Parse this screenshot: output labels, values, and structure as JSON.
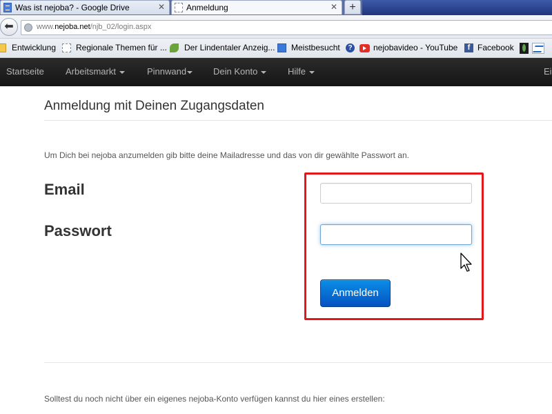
{
  "browser": {
    "tabs": [
      {
        "label": "Was ist nejoba? - Google Drive",
        "icon": "google-docs-icon",
        "close": "✕"
      },
      {
        "label": "Anmeldung",
        "icon": "blank-page-icon",
        "close": "✕"
      }
    ],
    "new_tab": "+",
    "url": {
      "prefix": "www.",
      "domain": "nejoba.net",
      "path": "/njb_02/login.aspx"
    },
    "bookmarks": [
      {
        "label": "Entwicklung",
        "icon": "folder-icon"
      },
      {
        "label": "Regionale Themen für ...",
        "icon": "blank-page-icon"
      },
      {
        "label": "Der Lindentaler Anzeig...",
        "icon": "leaf-icon"
      },
      {
        "label": "Meistbesucht",
        "icon": "star-icon"
      },
      {
        "label": "?",
        "icon": "help-icon"
      },
      {
        "label": "nejobavideo - YouTube",
        "icon": "youtube-icon"
      },
      {
        "label": "Facebook",
        "icon": "facebook-icon"
      }
    ],
    "facebook_glyph": "f"
  },
  "sitenav": {
    "items": [
      {
        "label": "Startseite",
        "dropdown": false
      },
      {
        "label": "Arbeitsmarkt",
        "dropdown": true
      },
      {
        "label": "Pinnwand",
        "dropdown": true
      },
      {
        "label": "Dein Konto",
        "dropdown": true
      },
      {
        "label": "Hilfe",
        "dropdown": true
      }
    ],
    "right_label": "Ei"
  },
  "page": {
    "heading": "Anmeldung mit Deinen Zugangsdaten",
    "intro": "Um Dich bei nejoba anzumelden gib bitte deine Mailadresse und das von dir gewählte Passwort an.",
    "email_label": "Email",
    "email_value": "",
    "password_label": "Passwort",
    "password_value": "",
    "login_button": "Anmelden",
    "footer_text": "Solltest du noch nicht über ein eigenes nejoba-Konto verfügen kannst du hier eines erstellen:",
    "highlight_color": "#e3161a",
    "button_color": "#0552c2"
  }
}
